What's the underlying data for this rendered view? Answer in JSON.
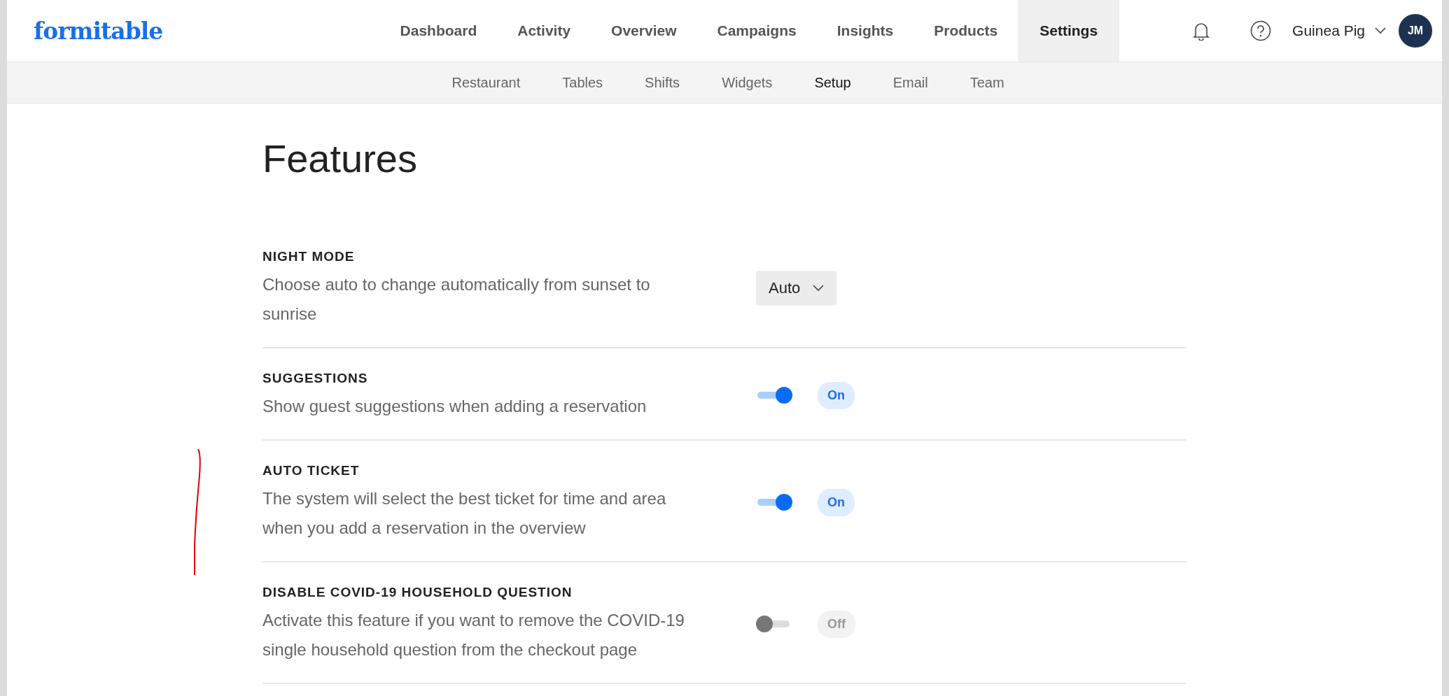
{
  "logo": "formitable",
  "nav": [
    {
      "label": "Dashboard",
      "selected": false
    },
    {
      "label": "Activity",
      "selected": false
    },
    {
      "label": "Overview",
      "selected": false
    },
    {
      "label": "Campaigns",
      "selected": false
    },
    {
      "label": "Insights",
      "selected": false
    },
    {
      "label": "Products",
      "selected": false
    },
    {
      "label": "Settings",
      "selected": true
    }
  ],
  "user": {
    "name": "Guinea Pig",
    "initials": "JM"
  },
  "subnav": [
    {
      "label": "Restaurant",
      "selected": false
    },
    {
      "label": "Tables",
      "selected": false
    },
    {
      "label": "Shifts",
      "selected": false
    },
    {
      "label": "Widgets",
      "selected": false
    },
    {
      "label": "Setup",
      "selected": true
    },
    {
      "label": "Email",
      "selected": false
    },
    {
      "label": "Team",
      "selected": false
    }
  ],
  "page_title": "Features",
  "features": [
    {
      "kind": "select",
      "title": "NIGHT MODE",
      "description": "Choose auto to change automatically from sunset to sunrise",
      "value": "Auto"
    },
    {
      "kind": "toggle",
      "title": "SUGGESTIONS",
      "description": "Show guest suggestions when adding a reservation",
      "on": true,
      "status": "On"
    },
    {
      "kind": "toggle",
      "title": "AUTO TICKET",
      "description": "The system will select the best ticket for time and area when you add a reservation in the overview",
      "on": true,
      "status": "On"
    },
    {
      "kind": "toggle",
      "title": "DISABLE COVID-19 HOUSEHOLD QUESTION",
      "description": "Activate this feature if you want to remove the COVID-19 single household question from the checkout page",
      "on": false,
      "status": "Off"
    }
  ]
}
